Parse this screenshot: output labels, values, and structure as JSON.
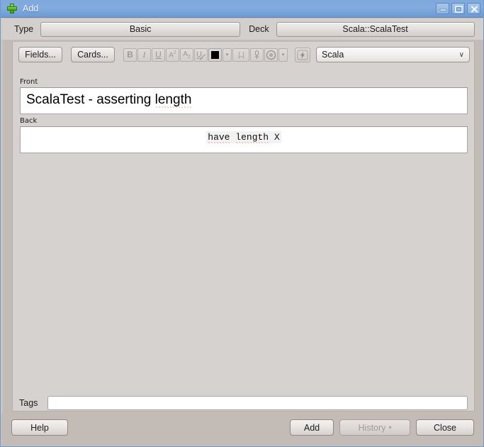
{
  "window": {
    "title": "Add",
    "icon": "anki-plus-icon",
    "accent_titlebar": "#82acdf",
    "background": "#d3cfcd",
    "controls": [
      {
        "name": "minimize",
        "glyph": "minimize-icon"
      },
      {
        "name": "maximize",
        "glyph": "maximize-icon"
      },
      {
        "name": "close",
        "glyph": "close-icon"
      }
    ]
  },
  "notetype_row": {
    "type_label": "Type",
    "type_value": "Basic",
    "deck_label": "Deck",
    "deck_value": "Scala::ScalaTest"
  },
  "toolbar": {
    "fields_label": "Fields...",
    "cards_label": "Cards...",
    "bold_label": "B",
    "italic_label": "I",
    "underline_label": "U",
    "superscript_label": "A",
    "superscript_sup": "2",
    "subscript_label": "A",
    "subscript_sub": "2",
    "clear_format_label": "U",
    "text_color": "#000000",
    "color_dropdown_label": "▾",
    "cloze_label": "[...]",
    "attach_label": "attachment-icon",
    "record_label": "record-icon",
    "more_dropdown_label": "▾",
    "equation_label": "lightning-icon",
    "language_value": "Scala",
    "language_chevron": "∨",
    "language_options": [
      "Scala"
    ]
  },
  "fields": [
    {
      "label": "Front",
      "value": "ScalaTest - asserting length",
      "plain_prefix": "ScalaTest - asserting ",
      "misspelled": "length",
      "style": "sans-large"
    },
    {
      "label": "Back",
      "value": "have length X",
      "misspelled_a": "have",
      "space": " ",
      "misspelled_b": "length",
      "plain_suffix": " X",
      "style": "mono-centered"
    }
  ],
  "tags": {
    "label": "Tags",
    "value": "",
    "placeholder": ""
  },
  "footer": {
    "help_label": "Help",
    "add_label": "Add",
    "history_label": "History",
    "history_caret": "▾",
    "history_enabled": false,
    "close_label": "Close"
  }
}
